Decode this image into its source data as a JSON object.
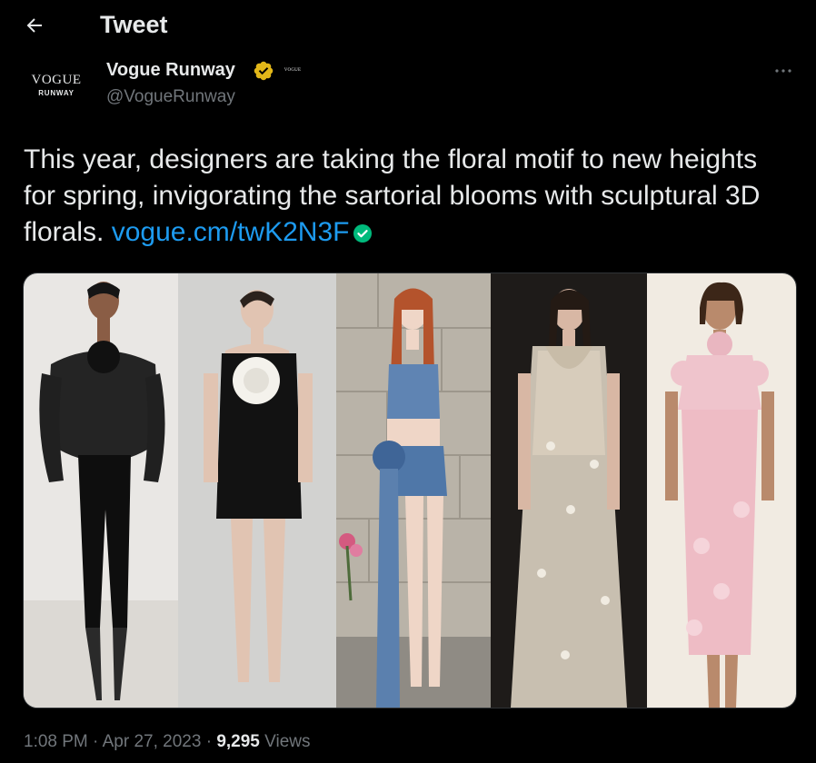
{
  "header": {
    "title": "Tweet"
  },
  "author": {
    "avatar_logo": "VOGUE",
    "avatar_sub": "RUNWAY",
    "name": "Vogue Runway",
    "affiliate_label": "VOGUE",
    "handle": "@VogueRunway"
  },
  "tweet": {
    "text": "This year, designers are taking the floral motif to new heights for spring, invigorating the sartorial blooms with sculptural 3D florals.",
    "link": "vogue.cm/twK2N3F"
  },
  "meta": {
    "time": "1:08 PM",
    "separator_1": "·",
    "date": "Apr 27, 2023",
    "separator_2": "·",
    "views_count": "9,295",
    "views_label": "Views"
  },
  "colors": {
    "background": "#000000",
    "text_primary": "#e7e9ea",
    "text_secondary": "#71767b",
    "link": "#1d9bf0",
    "verified_gold": "#e2b719",
    "link_badge_green": "#00ba7c"
  },
  "icons": {
    "back": "arrow-left-icon",
    "verified": "verified-badge-icon",
    "more": "more-horizontal-icon",
    "link_verified": "check-circle-icon"
  }
}
